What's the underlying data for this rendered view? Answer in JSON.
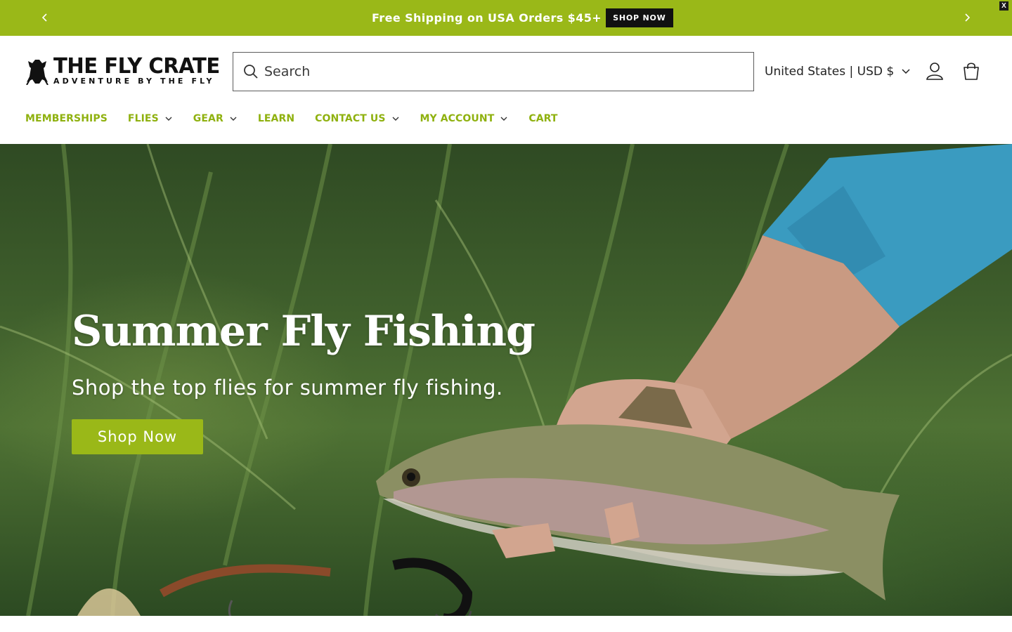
{
  "announcement": {
    "message": "Free Shipping on USA Orders $45+",
    "button_label": "SHOP NOW",
    "close_label": "X",
    "prev_icon": "chevron-left-icon",
    "next_icon": "chevron-right-icon"
  },
  "header": {
    "logo_title": "THE FLY CRATE",
    "logo_tagline": "ADVENTURE BY THE FLY",
    "search": {
      "placeholder": "Search",
      "value": ""
    },
    "locale": "United States | USD $",
    "account_icon": "user-icon",
    "cart_icon": "shopping-bag-icon"
  },
  "nav": {
    "items": [
      {
        "label": "MEMBERSHIPS",
        "has_dropdown": false
      },
      {
        "label": "FLIES",
        "has_dropdown": true
      },
      {
        "label": "GEAR",
        "has_dropdown": true
      },
      {
        "label": "LEARN",
        "has_dropdown": false
      },
      {
        "label": "CONTACT US",
        "has_dropdown": true
      },
      {
        "label": "MY ACCOUNT",
        "has_dropdown": true
      },
      {
        "label": "CART",
        "has_dropdown": false
      }
    ]
  },
  "hero": {
    "title": "Summer Fly Fishing",
    "subtitle": "Shop the top flies for summer fly fishing.",
    "button_label": "Shop Now"
  },
  "colors": {
    "brand_green": "#9ab818",
    "nav_green": "#8fb10f",
    "dark": "#111111"
  }
}
